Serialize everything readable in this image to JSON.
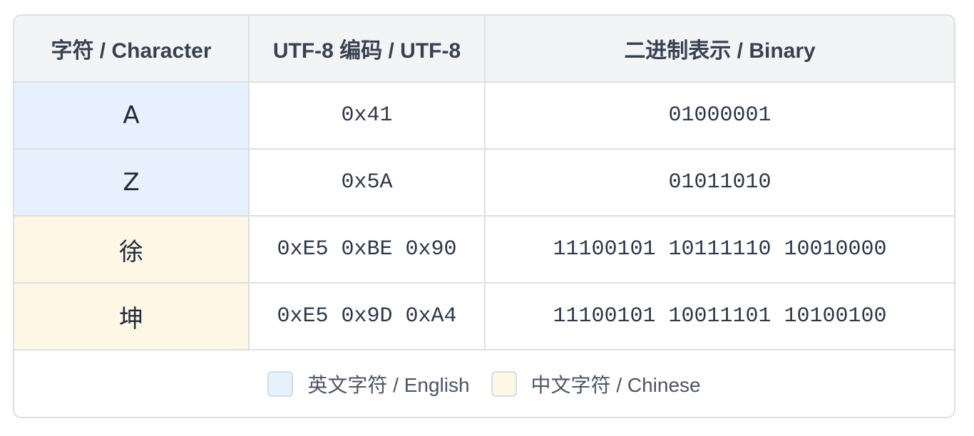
{
  "table": {
    "headers": [
      "字符 / Character",
      "UTF-8 编码 / UTF-8",
      "二进制表示 / Binary"
    ],
    "rows": [
      {
        "char": "A",
        "utf8": "0x41",
        "binary": "01000001",
        "lang": "en"
      },
      {
        "char": "Z",
        "utf8": "0x5A",
        "binary": "01011010",
        "lang": "en"
      },
      {
        "char": "徐",
        "utf8": "0xE5 0xBE 0x90",
        "binary": "11100101 10111110 10010000",
        "lang": "zh"
      },
      {
        "char": "坤",
        "utf8": "0xE5 0x9D 0xA4",
        "binary": "11100101 10011101 10100100",
        "lang": "zh"
      }
    ]
  },
  "legend": {
    "english": "英文字符 / English",
    "chinese": "中文字符 / Chinese"
  },
  "colors": {
    "english_fill": "#e6f1fd",
    "chinese_fill": "#fef7e6",
    "header_fill": "#f3f4f6",
    "border": "#dcdfe4"
  }
}
